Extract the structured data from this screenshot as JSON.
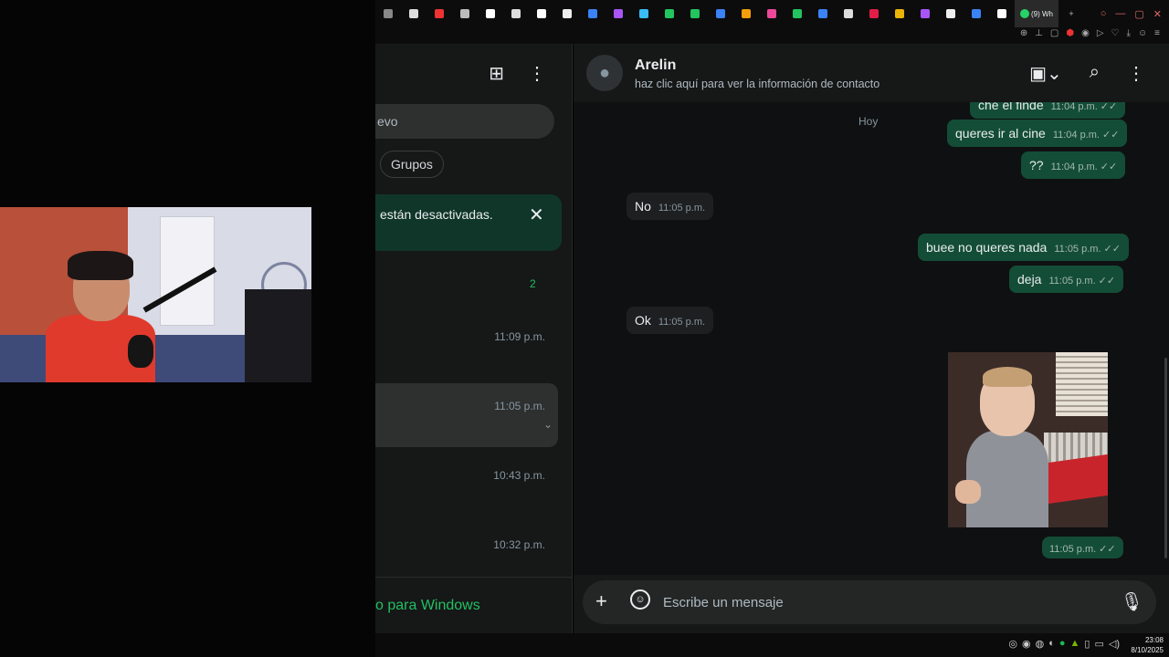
{
  "browser": {
    "active_tab_label": "(9) Wh",
    "tab_colors": [
      "#888",
      "#ddd",
      "#e33",
      "#bbb",
      "#fff",
      "#ddd",
      "#fff",
      "#eee",
      "#3b82f6",
      "#a855f7",
      "#38bdf8",
      "#22c55e",
      "#22c55e",
      "#3b82f6",
      "#f59e0b",
      "#ec4899",
      "#22c55e",
      "#3b82f6",
      "#ddd",
      "#e11d48",
      "#eab308",
      "#a855f7",
      "#eee",
      "#3b82f6",
      "#fff"
    ],
    "window_controls": [
      "search-icon",
      "minimize-icon",
      "restore-icon",
      "close-icon"
    ]
  },
  "sidebar": {
    "search_fragment": "evo",
    "chip_groups": "Grupos",
    "notification_text": "están desactivadas.",
    "archived_count": "2",
    "chats": [
      {
        "time": "11:09 p.m.",
        "selected": false
      },
      {
        "time": "11:05 p.m.",
        "selected": true
      },
      {
        "time": "10:43 p.m.",
        "selected": false
      },
      {
        "time": "10:32 p.m.",
        "selected": false
      }
    ],
    "windows_promo": "o para Windows"
  },
  "chat": {
    "contact_name": "Arelin",
    "contact_subtitle": "haz clic aquí para ver la información de contacto",
    "day_label": "Hoy",
    "messages": [
      {
        "dir": "out",
        "text": "che el finde",
        "time": "11:04 p.m."
      },
      {
        "dir": "out",
        "text": "queres ir al cine",
        "time": "11:04 p.m."
      },
      {
        "dir": "out",
        "text": "??",
        "time": "11:04 p.m."
      },
      {
        "dir": "in",
        "text": "No",
        "time": "11:05 p.m."
      },
      {
        "dir": "out",
        "text": "buee no queres nada",
        "time": "11:05 p.m."
      },
      {
        "dir": "out",
        "text": "deja",
        "time": "11:05 p.m."
      },
      {
        "dir": "in",
        "text": "Ok",
        "time": "11:05 p.m."
      }
    ],
    "image_time": "11:05 p.m.",
    "composer_placeholder": "Escribe un mensaje"
  },
  "taskbar": {
    "time": "23:08",
    "date": "8/10/2025"
  }
}
